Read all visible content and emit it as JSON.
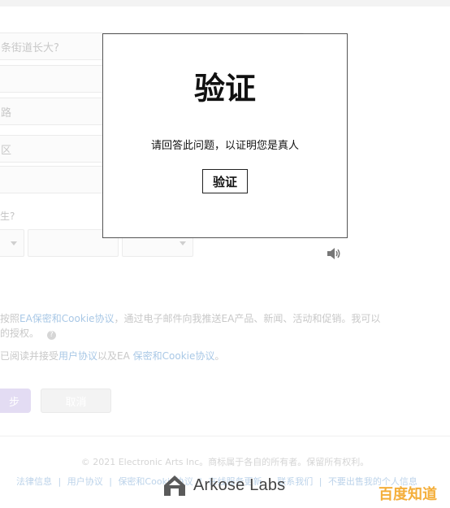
{
  "form": {
    "security_question": "条街道长大?",
    "street_field": "路",
    "district_field": "区",
    "birth_label": "生?",
    "speaker_icon": "speaker-icon",
    "legal_line1_prefix": "按照",
    "legal_line1_link": "EA保密和Cookie协议",
    "legal_line1_suffix": "，通过电子邮件向我推送EA产品、新闻、活动和促销。我可以",
    "legal_line2": "的授权。",
    "legal_line3_prefix": "已阅读并接受",
    "legal_line3_link1": "用户协议",
    "legal_line3_mid": "以及EA ",
    "legal_line3_link2": "保密和Cookie协议",
    "legal_line3_suffix": "。",
    "next_button": "步",
    "cancel_button": "取消"
  },
  "footer": {
    "copyright": "© 2021 Electronic Arts Inc。商标属于各自的所有者。保留所有权利。",
    "links": [
      "法律信息",
      "|",
      "用户协议",
      "|",
      "保密和Cookie协议",
      "|",
      "在线服务更新",
      "|",
      "联系我们",
      "|",
      "不要出售我的个人信息"
    ]
  },
  "modal": {
    "title": "验证",
    "message": "请回答此问题，以证明您是真人",
    "button": "验证"
  },
  "branding": {
    "arkose": "Arkose Labs",
    "watermark": "百度知道"
  }
}
